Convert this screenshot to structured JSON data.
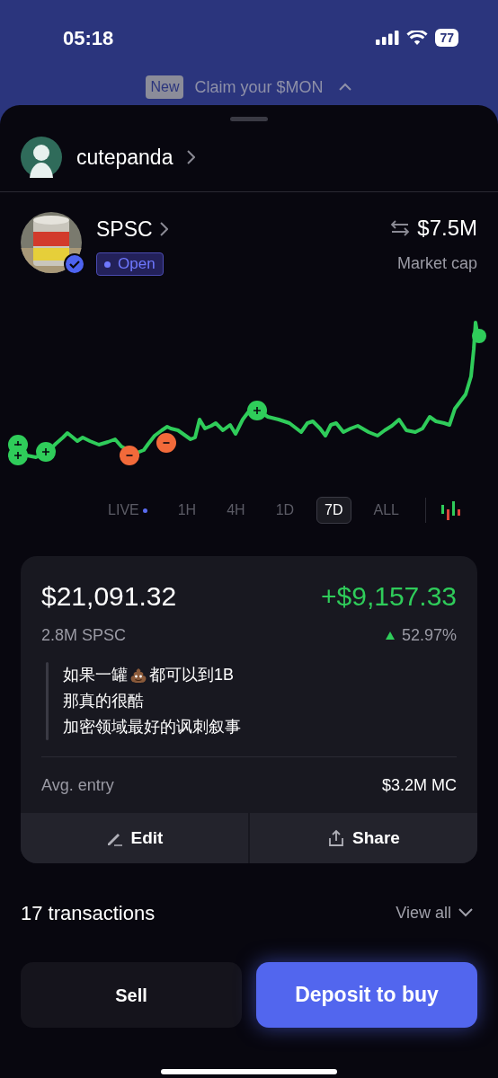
{
  "status_bar": {
    "time": "05:18",
    "battery": "77"
  },
  "banner": {
    "badge": "New",
    "text": "Claim your $MON"
  },
  "user": {
    "name": "cutepanda"
  },
  "token": {
    "symbol": "SPSC",
    "verified": true,
    "status": "Open",
    "market_cap": "$7.5M",
    "market_cap_label": "Market cap"
  },
  "time_ranges": [
    {
      "label": "LIVE",
      "live": true,
      "selected": false
    },
    {
      "label": "1H",
      "live": false,
      "selected": false
    },
    {
      "label": "4H",
      "live": false,
      "selected": false
    },
    {
      "label": "1D",
      "live": false,
      "selected": false
    },
    {
      "label": "7D",
      "live": false,
      "selected": true
    },
    {
      "label": "ALL",
      "live": false,
      "selected": false
    }
  ],
  "position": {
    "value": "$21,091.32",
    "pnl": "+$9,157.33",
    "amount": "2.8M SPSC",
    "pnl_percent": "52.97%",
    "gain": true,
    "note": [
      [
        {
          "kind": "text",
          "text": "如果一罐"
        },
        {
          "kind": "emoji"
        },
        {
          "kind": "text",
          "text": "都可以到1B"
        }
      ],
      [
        {
          "kind": "text",
          "text": "那真的很酷"
        }
      ],
      [
        {
          "kind": "text",
          "text": "加密领域最好的讽刺叙事"
        }
      ]
    ],
    "avg_entry_label": "Avg. entry",
    "avg_entry": "$3.2M MC",
    "actions": [
      {
        "label": "Edit",
        "kind": "edit"
      },
      {
        "label": "Share",
        "kind": "share"
      }
    ]
  },
  "transactions": {
    "title": "17 transactions",
    "link": "View all"
  },
  "buttons": [
    {
      "label": "Sell",
      "kind": "secondary"
    },
    {
      "label": "Deposit to buy",
      "kind": "primary"
    }
  ]
}
